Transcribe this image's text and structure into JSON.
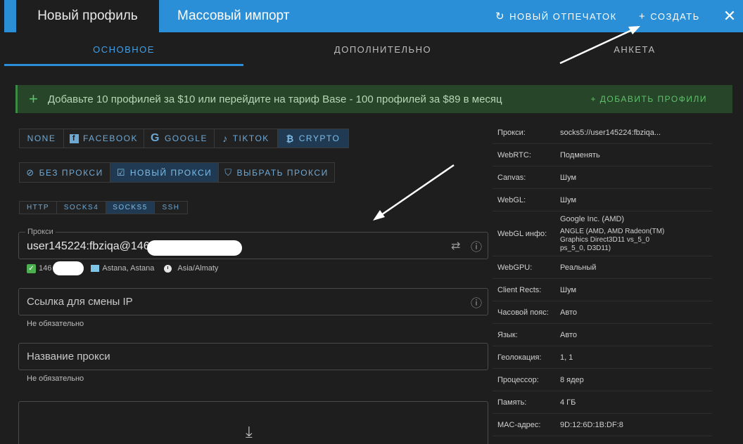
{
  "header": {
    "tab_new": "Новый профиль",
    "tab_import": "Массовый импорт",
    "fingerprint_label": "НОВЫЙ ОТПЕЧАТОК",
    "create_label": "СОЗДАТЬ",
    "accent": "#2a8fd6"
  },
  "subtabs": [
    "ОСНОВНОЕ",
    "ДОПОЛНИТЕЛЬНО",
    "АНКЕТА"
  ],
  "banner": {
    "text": "Добавьте 10 профилей за $10 или перейдите на тариф Base - 100 профилей за $89 в месяц",
    "action": "+ ДОБАВИТЬ ПРОФИЛИ"
  },
  "platforms": [
    {
      "label": "NONE",
      "icon": ""
    },
    {
      "label": "FACEBOOK",
      "icon": "facebook-icon"
    },
    {
      "label": "GOOGLE",
      "icon": "google-icon"
    },
    {
      "label": "TIKTOK",
      "icon": "tiktok-icon"
    },
    {
      "label": "CRYPTO",
      "icon": "bitcoin-icon",
      "selected": true
    }
  ],
  "proxy_modes": [
    {
      "label": "БЕЗ ПРОКСИ",
      "icon": "block-icon"
    },
    {
      "label": "НОВЫЙ ПРОКСИ",
      "icon": "edit-icon",
      "selected": true
    },
    {
      "label": "ВЫБРАТЬ ПРОКСИ",
      "icon": "bookmark-icon"
    }
  ],
  "protocols": [
    {
      "label": "HTTP"
    },
    {
      "label": "SOCKS4"
    },
    {
      "label": "SOCKS5",
      "selected": true
    },
    {
      "label": "SSH"
    }
  ],
  "proxy_field": {
    "label": "Прокси",
    "value": "user145224:fbziqa@146"
  },
  "proxy_meta": {
    "ip": "146",
    "location": "Astana, Astana",
    "timezone": "Asia/Almaty"
  },
  "ip_change_field": {
    "placeholder": "Ссылка для смены IP",
    "hint": "Не обязательно"
  },
  "proxy_name_field": {
    "placeholder": "Название прокси",
    "hint": "Не обязательно"
  },
  "summary": [
    {
      "key": "Прокси:",
      "value": [
        "socks5://user145224:fbziqa..."
      ]
    },
    {
      "key": "WebRTC:",
      "value": [
        "Подменять"
      ]
    },
    {
      "key": "Canvas:",
      "value": [
        "Шум"
      ]
    },
    {
      "key": "WebGL:",
      "value": [
        "Шум"
      ]
    },
    {
      "key": "WebGL инфо:",
      "value": [
        "Google Inc. (AMD)",
        "ANGLE (AMD, AMD Radeon(TM)",
        "Graphics Direct3D11 vs_5_0",
        "ps_5_0, D3D11)"
      ]
    },
    {
      "key": "WebGPU:",
      "value": [
        "Реальный"
      ]
    },
    {
      "key": "Client Rects:",
      "value": [
        "Шум"
      ]
    },
    {
      "key": "Часовой пояс:",
      "value": [
        "Авто"
      ]
    },
    {
      "key": "Язык:",
      "value": [
        "Авто"
      ]
    },
    {
      "key": "Геолокация:",
      "value": [
        "1, 1"
      ]
    },
    {
      "key": "Процессор:",
      "value": [
        "8 ядер"
      ]
    },
    {
      "key": "Память:",
      "value": [
        "4 ГБ"
      ]
    },
    {
      "key": "MAC-адрес:",
      "value": [
        "9D:12:6D:1B:DF:8"
      ]
    }
  ]
}
